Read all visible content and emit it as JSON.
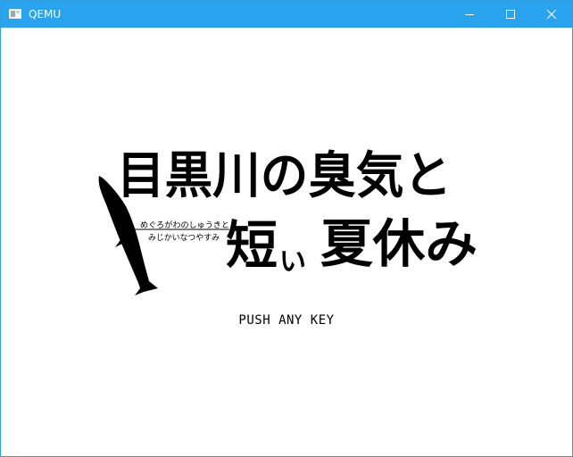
{
  "window": {
    "title": "QEMU",
    "titlebar_color": "#2aa3ee",
    "controls": {
      "minimize_icon": "minimize-icon",
      "maximize_icon": "maximize-icon",
      "close_icon": "close-icon"
    }
  },
  "game": {
    "title_line1": "目黒川の臭気と",
    "title_line2_a": "短",
    "title_line2_b": "い",
    "title_line2_c": "夏休み",
    "ruby_line1": "めぐろがわのしゅうきと",
    "ruby_line2": "みじかいなつやすみ",
    "prompt": "PUSH ANY KEY",
    "logo_icon": "fish-icon"
  }
}
